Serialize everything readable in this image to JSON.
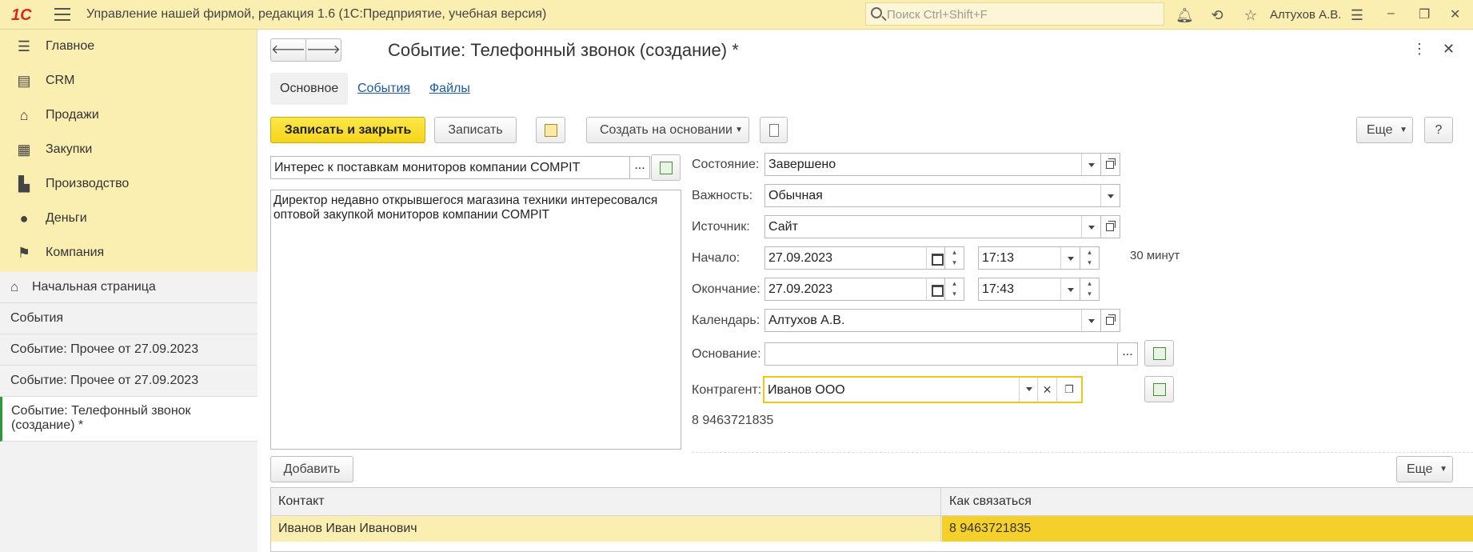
{
  "app": {
    "logo": "1С",
    "title": "Управление нашей фирмой, редакция 1.6  (1С:Предприятие, учебная версия)",
    "search_placeholder": "Поиск Ctrl+Shift+F",
    "user": "Алтухов А.В."
  },
  "sidebar": {
    "items": [
      {
        "label": "Главное",
        "icon": "list-icon"
      },
      {
        "label": "CRM",
        "icon": "contacts-icon"
      },
      {
        "label": "Продажи",
        "icon": "basket-icon"
      },
      {
        "label": "Закупки",
        "icon": "cart-icon"
      },
      {
        "label": "Производство",
        "icon": "factory-icon"
      },
      {
        "label": "Деньги",
        "icon": "ruble-icon"
      },
      {
        "label": "Компания",
        "icon": "flag-icon"
      }
    ],
    "open_windows": [
      "Начальная страница",
      "События",
      "Событие: Прочее от 27.09.2023",
      "Событие: Прочее от 27.09.2023",
      "Событие: Телефонный звонок (создание) *"
    ]
  },
  "form": {
    "title": "Событие: Телефонный звонок (создание) *",
    "tabs": [
      "Основное",
      "События",
      "Файлы"
    ],
    "toolbar": {
      "save_close": "Записать и закрыть",
      "save": "Записать",
      "create_based": "Создать на основании",
      "more": "Еще",
      "help": "?"
    },
    "subject": "Интерес к поставкам мониторов компании COMPIT",
    "description": "Директор недавно открывшегося магазина техники интересовался оптовой закупкой мониторов компании COMPIT",
    "fields": {
      "state_label": "Состояние:",
      "state": "Завершено",
      "importance_label": "Важность:",
      "importance": "Обычная",
      "source_label": "Источник:",
      "source": "Сайт",
      "start_label": "Начало:",
      "start_date": "27.09.2023",
      "start_time": "17:13",
      "duration": "30 минут",
      "end_label": "Окончание:",
      "end_date": "27.09.2023",
      "end_time": "17:43",
      "calendar_label": "Календарь:",
      "calendar": "Алтухов А.В.",
      "basis_label": "Основание:",
      "basis": "",
      "counterparty_label": "Контрагент:",
      "counterparty": "Иванов ООО",
      "phone": "8 9463721835"
    },
    "contacts": {
      "add": "Добавить",
      "more": "Еще",
      "columns": [
        "Контакт",
        "Как связаться"
      ],
      "rows": [
        [
          "Иванов Иван Иванович",
          "8 9463721835"
        ]
      ]
    }
  }
}
